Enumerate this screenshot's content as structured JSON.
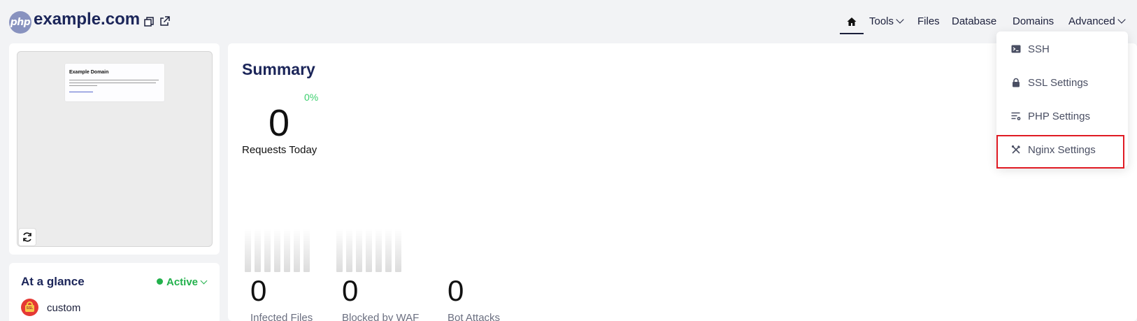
{
  "header": {
    "logo_text": "php",
    "domain": "example.com",
    "nav": {
      "tools": "Tools",
      "files": "Files",
      "database": "Database",
      "domains": "Domains",
      "advanced": "Advanced"
    }
  },
  "preview": {
    "mini_title": "Example Domain"
  },
  "glance": {
    "title": "At a glance",
    "status": "Active",
    "ssl_label": "custom",
    "ssl_badge_text": "SSL"
  },
  "summary": {
    "title": "Summary",
    "change_pct": "0%",
    "requests_value": "0",
    "requests_label": "Requests Today",
    "metrics": [
      {
        "value": "0",
        "label": "Infected Files"
      },
      {
        "value": "0",
        "label": "Blocked by WAF"
      },
      {
        "value": "0",
        "label": "Bot Attacks"
      }
    ]
  },
  "advanced_menu": {
    "items": [
      {
        "label": "SSH",
        "icon": "terminal-icon"
      },
      {
        "label": "SSL Settings",
        "icon": "lock-icon"
      },
      {
        "label": "PHP Settings",
        "icon": "settings-list-icon"
      },
      {
        "label": "Nginx Settings",
        "icon": "tools-icon"
      }
    ],
    "highlighted": "Nginx Settings"
  },
  "colors": {
    "brand_dark": "#1b2559",
    "active_green": "#22b14c",
    "percent_green": "#3ccf6e",
    "highlight_red": "#e01b24",
    "php_purple": "#8892bf"
  }
}
